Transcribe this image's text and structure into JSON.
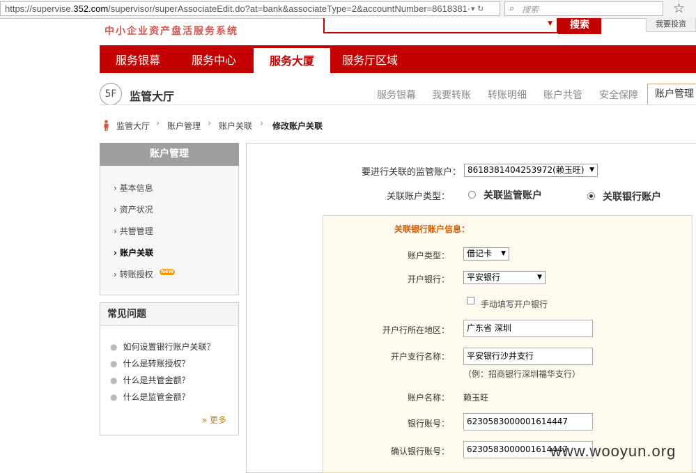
{
  "browser": {
    "url_prefix": "https://supervise.",
    "url_domain": "352.com",
    "url_rest": "/supervisor/superAssociateEdit.do?at=bank&associateType=2&accountNumber=8618381·",
    "search_placeholder": "搜索"
  },
  "header": {
    "slogan": "中小企业资产盘活服务系统",
    "search_button": "搜索",
    "invest_button": "我要投资"
  },
  "mainnav": {
    "items": [
      "服务银幕",
      "服务中心",
      "服务大厦",
      "服务厅区域"
    ],
    "active": "服务大厦"
  },
  "subheader": {
    "floor": "5F",
    "title": "监管大厅",
    "items": [
      "服务银幕",
      "我要转账",
      "转账明细",
      "账户共管",
      "安全保障"
    ],
    "active": "账户管理"
  },
  "breadcrumb": [
    "监管大厅",
    "账户管理",
    "账户关联",
    "修改账户关联"
  ],
  "sidebar": {
    "title": "账户管理",
    "items": [
      "基本信息",
      "资产状况",
      "共管管理",
      "账户关联",
      "转账授权"
    ],
    "new_badge": "NEW"
  },
  "faq": {
    "title": "常见问题",
    "items": [
      "如何设置银行账户关联？",
      "什么是转账授权？",
      "什么是共管金额？",
      "什么是监管金额？"
    ],
    "more": "更多"
  },
  "form": {
    "supervise_account_label": "要进行关联的监管账户：",
    "supervise_account_value": "8618381404253972(赖玉旺)",
    "assoc_type_label": "关联账户类型：",
    "assoc_type_option1": "关联监管账户",
    "assoc_type_option2": "关联银行账户",
    "info_title": "关联银行账户信息：",
    "account_type_label": "账户类型：",
    "account_type_value": "借记卡",
    "bank_label": "开户银行：",
    "bank_value": "平安银行",
    "manual_bank_label": "手动填写开户银行",
    "region_label": "开户行所在地区：",
    "region_value": "广东省 深圳",
    "branch_label": "开户支行名称：",
    "branch_value": "平安银行沙井支行",
    "branch_hint": "（例：招商银行深圳福华支行）",
    "account_name_label": "账户名称：",
    "account_name_value": "赖玉旺",
    "account_no_label": "银行账号：",
    "account_no_value": "6230583000001614447",
    "confirm_no_label": "确认银行账号：",
    "confirm_no_value": "6230583000001614447"
  },
  "watermark": "www.wooyun.org"
}
